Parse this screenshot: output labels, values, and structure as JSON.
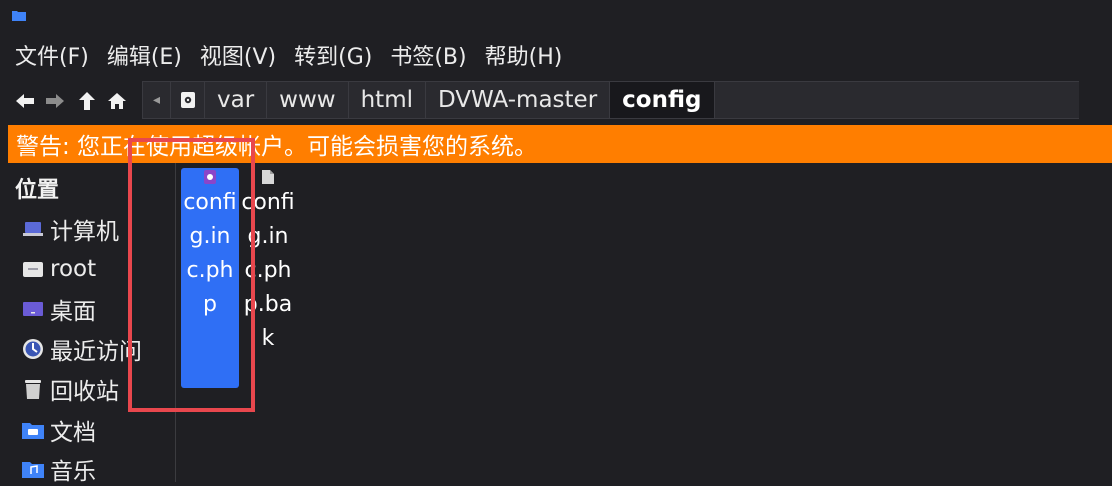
{
  "menu": [
    "文件(F)",
    "编辑(E)",
    "视图(V)",
    "转到(G)",
    "书签(B)",
    "帮助(H)"
  ],
  "path": [
    "var",
    "www",
    "html",
    "DVWA-master",
    "config"
  ],
  "warning": "警告: 您正在使用超级帐户。可能会损害您的系统。",
  "sidebar": {
    "heading": "位置",
    "items": [
      {
        "label": "计算机",
        "icon": "computer-icon"
      },
      {
        "label": "root",
        "icon": "home-folder-icon"
      },
      {
        "label": "桌面",
        "icon": "desktop-icon"
      },
      {
        "label": "最近访问",
        "icon": "recent-icon"
      },
      {
        "label": "回收站",
        "icon": "trash-icon"
      },
      {
        "label": "文档",
        "icon": "documents-folder-icon"
      },
      {
        "label": "音乐",
        "icon": "music-folder-icon"
      }
    ]
  },
  "files": [
    {
      "name": "config.inc.php",
      "icon": "php-file-icon",
      "selected": true
    },
    {
      "name": "config.inc.php.bak",
      "icon": "file-icon",
      "selected": false
    }
  ],
  "colors": {
    "warning": "#ff7e00",
    "selection": "#2f6ff5",
    "highlight_box": "#e8474d"
  }
}
